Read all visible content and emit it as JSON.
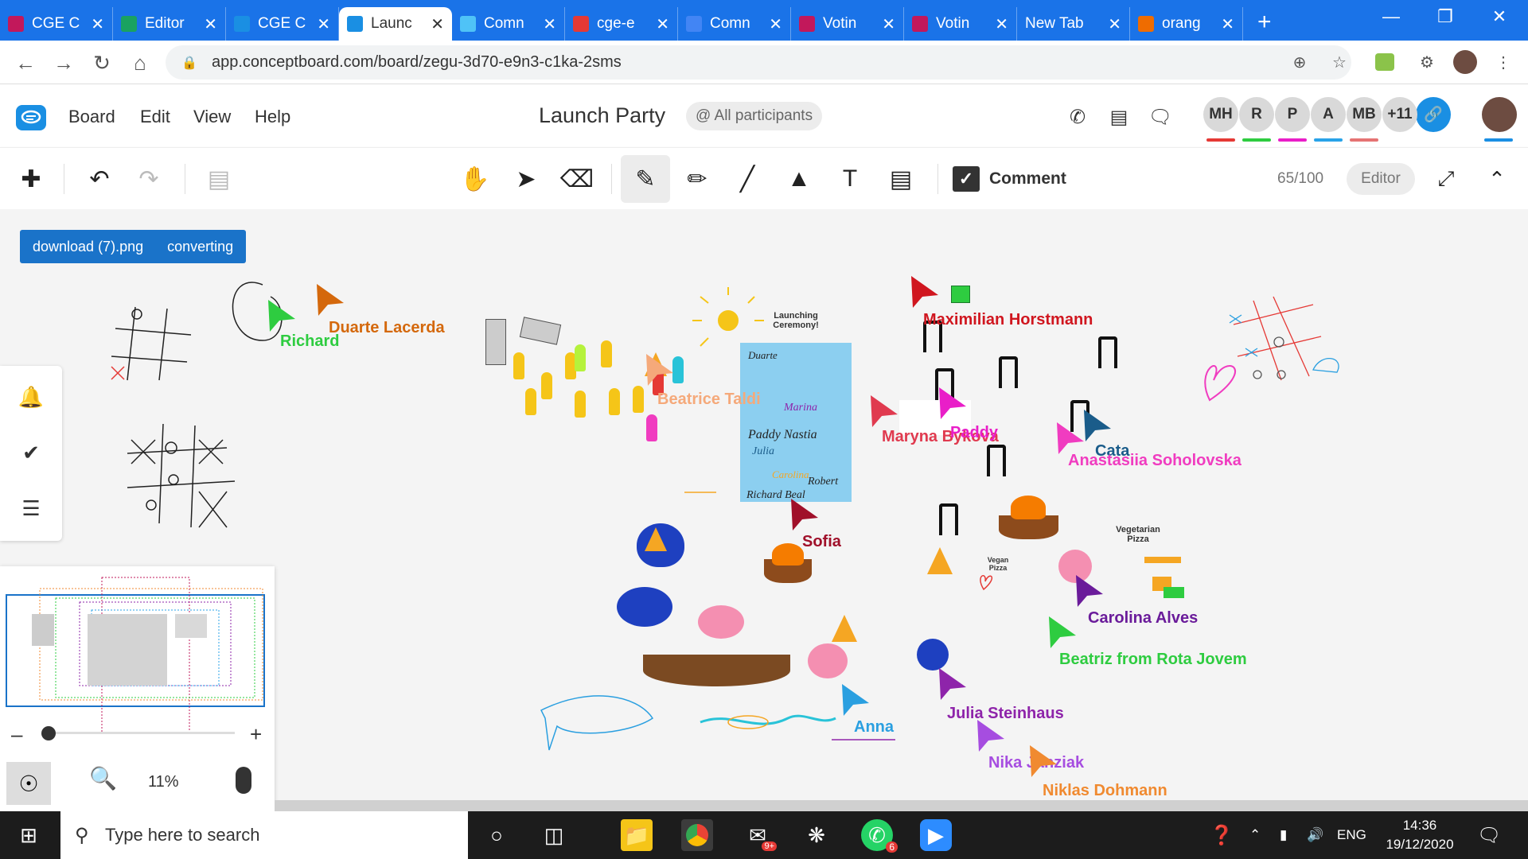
{
  "browser": {
    "tabs": [
      {
        "label": "CGE C",
        "fav": "#c2185b",
        "active": false
      },
      {
        "label": "Editor",
        "fav": "#1aa260",
        "active": false
      },
      {
        "label": "CGE C",
        "fav": "#1a8fe3",
        "active": false
      },
      {
        "label": "Launc",
        "fav": "#1a8fe3",
        "active": true
      },
      {
        "label": "Comn",
        "fav": "#4fc3f7",
        "active": false
      },
      {
        "label": "cge-e",
        "fav": "#e53935",
        "active": false
      },
      {
        "label": "Comn",
        "fav": "#4285f4",
        "active": false
      },
      {
        "label": "Votin",
        "fav": "#c2185b",
        "active": false
      },
      {
        "label": "Votin",
        "fav": "#c2185b",
        "active": false
      },
      {
        "label": "New Tab",
        "fav": "",
        "active": false
      },
      {
        "label": "orang",
        "fav": "#ef6c00",
        "active": false
      }
    ],
    "url": "app.conceptboard.com/board/zegu-3d70-e9n3-c1ka-2sms"
  },
  "app": {
    "menu": [
      "Board",
      "Edit",
      "View",
      "Help"
    ],
    "board_title": "Launch Party",
    "participants_label": "@ All participants",
    "avatars": [
      {
        "initials": "MH",
        "color": "#e53935"
      },
      {
        "initials": "R",
        "color": "#2ecc40"
      },
      {
        "initials": "P",
        "color": "#e91ec8"
      },
      {
        "initials": "A",
        "color": "#29a3e8"
      },
      {
        "initials": "MB",
        "color": "#e57373"
      },
      {
        "initials": "+11",
        "color": ""
      }
    ]
  },
  "toolbar": {
    "comment_label": "Comment",
    "counter": "65/100",
    "role": "Editor"
  },
  "canvas": {
    "upload": {
      "file": "download (7).png",
      "status": "converting"
    },
    "stickers": {
      "launching": "Launching Ceremony!",
      "vegetarian": "Vegetarian Pizza",
      "vegan": "Vegan Pizza"
    },
    "cursors": [
      {
        "name": "Richard",
        "color": "#2ecc40"
      },
      {
        "name": "Duarte Lacerda",
        "color": "#d4680c"
      },
      {
        "name": "Maximilian Horstmann",
        "color": "#d0161f"
      },
      {
        "name": "Beatrice Taldi",
        "color": "#f5a97a"
      },
      {
        "name": "Maryna Bykova",
        "color": "#e03a4f"
      },
      {
        "name": "Paddy",
        "color": "#e91ec8"
      },
      {
        "name": "Cata",
        "color": "#1a5c8a"
      },
      {
        "name": "Anastasiia Soholovska",
        "color": "#f03cc0"
      },
      {
        "name": "Sofia",
        "color": "#a0102a"
      },
      {
        "name": "Carolina Alves",
        "color": "#6a1b9a"
      },
      {
        "name": "Beatriz from Rota Jovem",
        "color": "#2ecc40"
      },
      {
        "name": "Anna",
        "color": "#2a9fe0"
      },
      {
        "name": "Julia Steinhaus",
        "color": "#8e24aa"
      },
      {
        "name": "Nika Janziak",
        "color": "#a64de0"
      },
      {
        "name": "Niklas Dohmann",
        "color": "#f08a30"
      }
    ]
  },
  "zoom": {
    "level": "11%"
  },
  "taskbar": {
    "search_placeholder": "Type here to search",
    "lang": "ENG",
    "time": "14:36",
    "date": "19/12/2020",
    "badge_mail": "9+",
    "badge_whatsapp": "6"
  }
}
